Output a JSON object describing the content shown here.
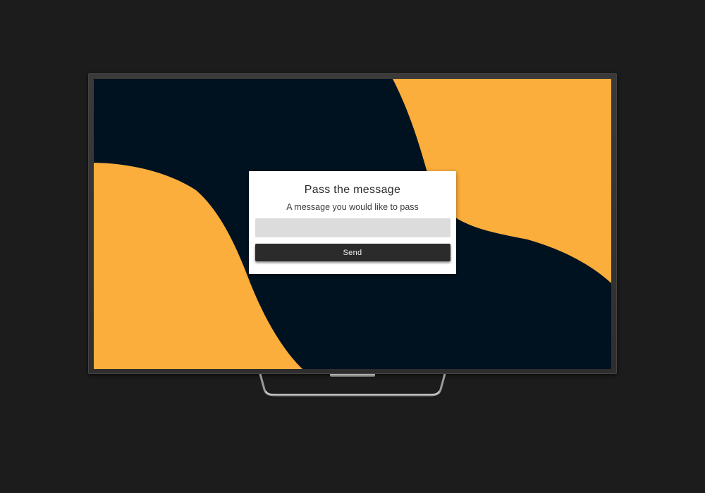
{
  "dialog": {
    "title": "Pass the message",
    "subtitle": "A message you would like to pass",
    "input_value": "",
    "input_placeholder": "",
    "send_label": "Send"
  },
  "colors": {
    "page_background": "#1c1c1c",
    "screen_background": "#001220",
    "wave_accent": "#fbae3c",
    "button_background": "#2b2b2b",
    "input_background": "#dcdcdc"
  }
}
